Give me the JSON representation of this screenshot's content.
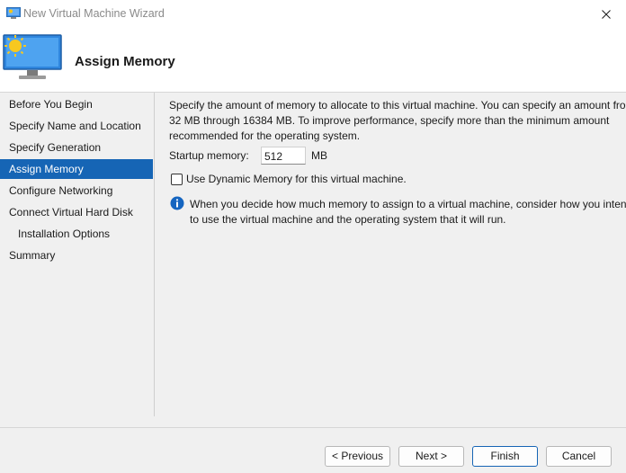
{
  "window": {
    "title": "New Virtual Machine Wizard",
    "icon": "hyperv-vm-icon",
    "close_icon": "close-icon"
  },
  "header": {
    "title": "Assign Memory",
    "icon": "monitor-sun-icon"
  },
  "sidebar": {
    "items": [
      {
        "label": "Before You Begin",
        "active": false
      },
      {
        "label": "Specify Name and Location",
        "active": false
      },
      {
        "label": "Specify Generation",
        "active": false
      },
      {
        "label": "Assign Memory",
        "active": true
      },
      {
        "label": "Configure Networking",
        "active": false
      },
      {
        "label": "Connect Virtual Hard Disk",
        "active": false
      },
      {
        "label": "Installation Options",
        "active": false
      },
      {
        "label": "Summary",
        "active": false
      }
    ]
  },
  "main": {
    "description": [
      "Specify the amount of memory to allocate to this virtual machine. You can specify an amount from",
      "32 MB through 16384 MB. To improve performance, specify more than the minimum amount",
      "recommended for the operating system."
    ],
    "startup_memory_label": "Startup memory:",
    "startup_memory_value": "512",
    "startup_memory_unit": "MB",
    "dynamic_memory_label": "Use Dynamic Memory for this virtual machine.",
    "dynamic_memory_checked": false,
    "info_text": [
      "When you decide how much memory to assign to a virtual machine, consider how you intend",
      "to use the virtual machine and the operating system that it will run."
    ]
  },
  "footer": {
    "previous_label": "< Previous",
    "next_label": "Next >",
    "finish_label": "Finish",
    "cancel_label": "Cancel"
  },
  "colors": {
    "accent": "#1665b5",
    "info": "#1565c0"
  }
}
